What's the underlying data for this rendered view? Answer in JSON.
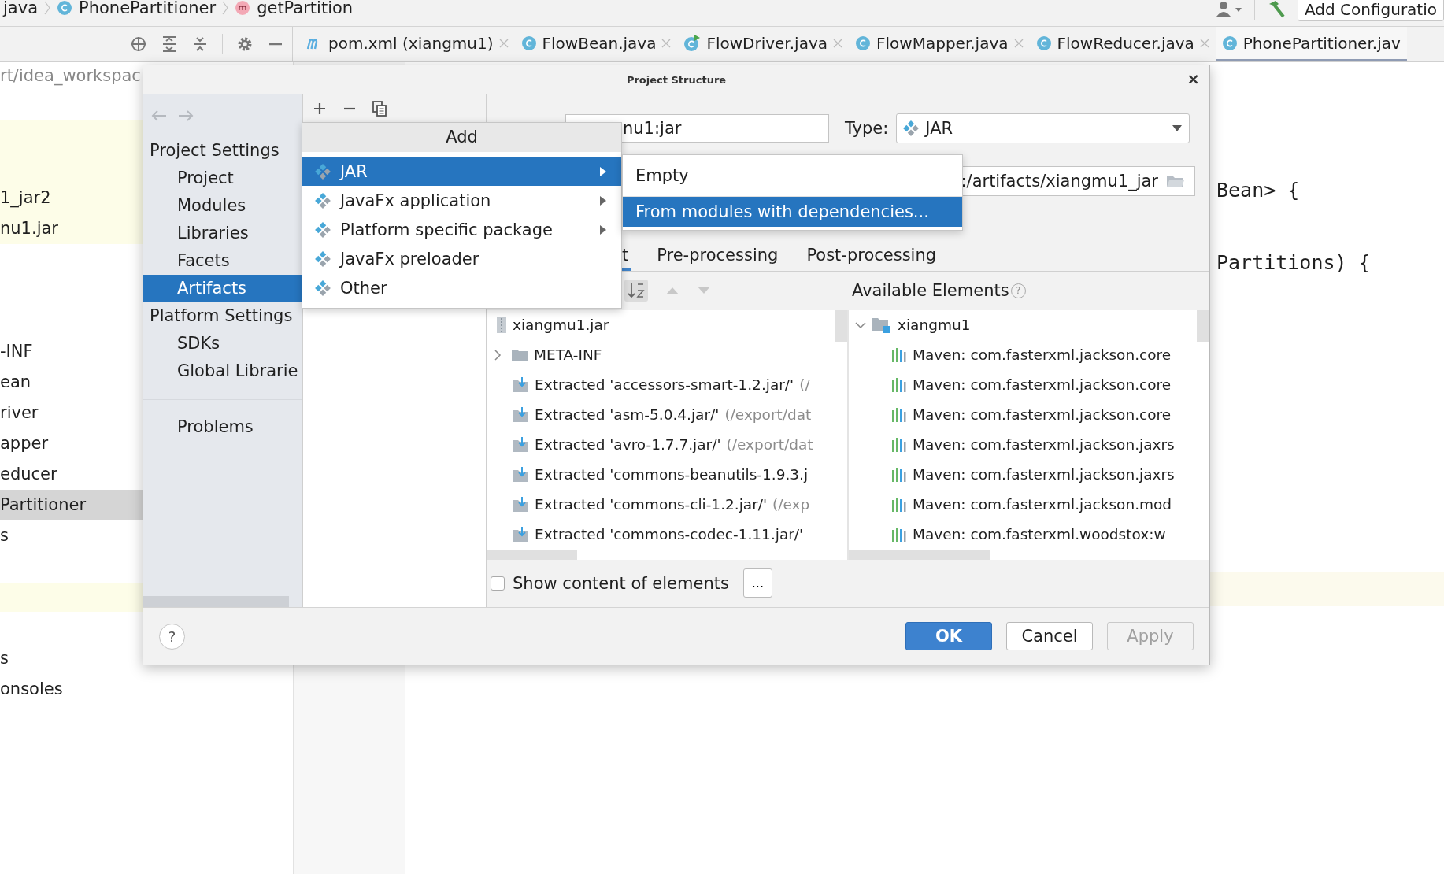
{
  "breadcrumb": [
    {
      "label": "java",
      "kind": "package"
    },
    {
      "label": "PhonePartitioner",
      "kind": "class"
    },
    {
      "label": "getPartition",
      "kind": "method"
    }
  ],
  "run_config": {
    "label": "Add Configuratio"
  },
  "editor_tabs": [
    {
      "label": "pom.xml (xiangmu1)",
      "kind": "maven",
      "selected": false
    },
    {
      "label": "FlowBean.java",
      "kind": "class",
      "selected": false
    },
    {
      "label": "FlowDriver.java",
      "kind": "runnable",
      "selected": false
    },
    {
      "label": "FlowMapper.java",
      "kind": "class",
      "selected": false
    },
    {
      "label": "FlowReducer.java",
      "kind": "class",
      "selected": false
    },
    {
      "label": "PhonePartitioner.jav",
      "kind": "class",
      "selected": true
    }
  ],
  "project_view": {
    "path": "rt/idea_workspac",
    "groups": [
      {
        "highlight": true,
        "items": [
          {
            "label": "1_jar2",
            "selected": false
          },
          {
            "label": "nu1.jar",
            "selected": false
          }
        ]
      },
      {
        "highlight": false,
        "items": [
          {
            "label": "-INF",
            "selected": false
          },
          {
            "label": "ean",
            "selected": false
          },
          {
            "label": "river",
            "selected": false
          },
          {
            "label": "apper",
            "selected": false
          },
          {
            "label": "educer",
            "selected": false
          },
          {
            "label": "Partitioner",
            "selected": true
          },
          {
            "label": "s",
            "selected": false
          }
        ]
      },
      {
        "highlight": false,
        "items": [
          {
            "label": "s",
            "selected": false
          },
          {
            "label": "onsoles",
            "selected": false
          }
        ]
      }
    ]
  },
  "editor": {
    "lines": [
      "Bean> {",
      "Partitions) {"
    ]
  },
  "dialog": {
    "title": "Project Structure",
    "close": "×",
    "nav": [
      {
        "heading": "Project Settings",
        "items": [
          {
            "label": "Project",
            "selected": false
          },
          {
            "label": "Modules",
            "selected": false
          },
          {
            "label": "Libraries",
            "selected": false
          },
          {
            "label": "Facets",
            "selected": false
          },
          {
            "label": "Artifacts",
            "selected": true
          }
        ]
      },
      {
        "heading": "Platform Settings",
        "items": [
          {
            "label": "SDKs",
            "selected": false
          },
          {
            "label": "Global Librarie",
            "selected": false
          }
        ]
      },
      {
        "items": [
          {
            "label": "Problems",
            "selected": false
          }
        ]
      }
    ],
    "name_value": "nu1:jar",
    "type_label": "Type:",
    "type_value": "JAR",
    "output_dir": ":/artifacts/xiangmu1_jar",
    "tabs": [
      {
        "label": "t",
        "selected": true
      },
      {
        "label": "Pre-processing",
        "selected": false
      },
      {
        "label": "Post-processing",
        "selected": false
      }
    ],
    "available_label": "Available Elements",
    "available_help": "?",
    "layout_tree": [
      {
        "label": "xiangmu1.jar",
        "kind": "jar"
      },
      {
        "label": "META-INF",
        "kind": "folder",
        "expanded": false
      },
      {
        "label": "Extracted 'accessors-smart-1.2.jar/'",
        "note": "(/",
        "kind": "extracted"
      },
      {
        "label": "Extracted 'asm-5.0.4.jar/'",
        "note": "(/export/dat",
        "kind": "extracted"
      },
      {
        "label": "Extracted 'avro-1.7.7.jar/'",
        "note": "(/export/dat",
        "kind": "extracted"
      },
      {
        "label": "Extracted 'commons-beanutils-1.9.3.j",
        "kind": "extracted"
      },
      {
        "label": "Extracted 'commons-cli-1.2.jar/'",
        "note": "(/exp",
        "kind": "extracted"
      },
      {
        "label": "Extracted 'commons-codec-1.11.jar/'",
        "kind": "extracted"
      }
    ],
    "available_tree": {
      "label": "xiangmu1",
      "expanded": true,
      "children": [
        {
          "label": "Maven: com.fasterxml.jackson.core"
        },
        {
          "label": "Maven: com.fasterxml.jackson.core"
        },
        {
          "label": "Maven: com.fasterxml.jackson.core"
        },
        {
          "label": "Maven: com.fasterxml.jackson.jaxrs"
        },
        {
          "label": "Maven: com.fasterxml.jackson.jaxrs"
        },
        {
          "label": "Maven: com.fasterxml.jackson.mod"
        },
        {
          "label": "Maven: com.fasterxml.woodstox:w"
        }
      ]
    },
    "show_content": {
      "label": "Show content of elements",
      "checked": false
    },
    "more_button": "...",
    "help": "?",
    "buttons": [
      {
        "label": "OK",
        "kind": "primary",
        "disabled": false
      },
      {
        "label": "Cancel",
        "kind": "normal",
        "disabled": false
      },
      {
        "label": "Apply",
        "kind": "normal",
        "disabled": true
      }
    ]
  },
  "add_menu": {
    "title": "Add",
    "items": [
      {
        "label": "JAR",
        "selected": true,
        "submenu": true
      },
      {
        "label": "JavaFx application",
        "selected": false,
        "submenu": true
      },
      {
        "label": "Platform specific package",
        "selected": false,
        "submenu": true
      },
      {
        "label": "JavaFx preloader",
        "selected": false,
        "submenu": false
      },
      {
        "label": "Other",
        "selected": false,
        "submenu": false
      }
    ]
  },
  "jar_submenu": {
    "items": [
      {
        "label": "Empty",
        "selected": false
      },
      {
        "label": "From modules with dependencies...",
        "selected": true
      }
    ]
  }
}
